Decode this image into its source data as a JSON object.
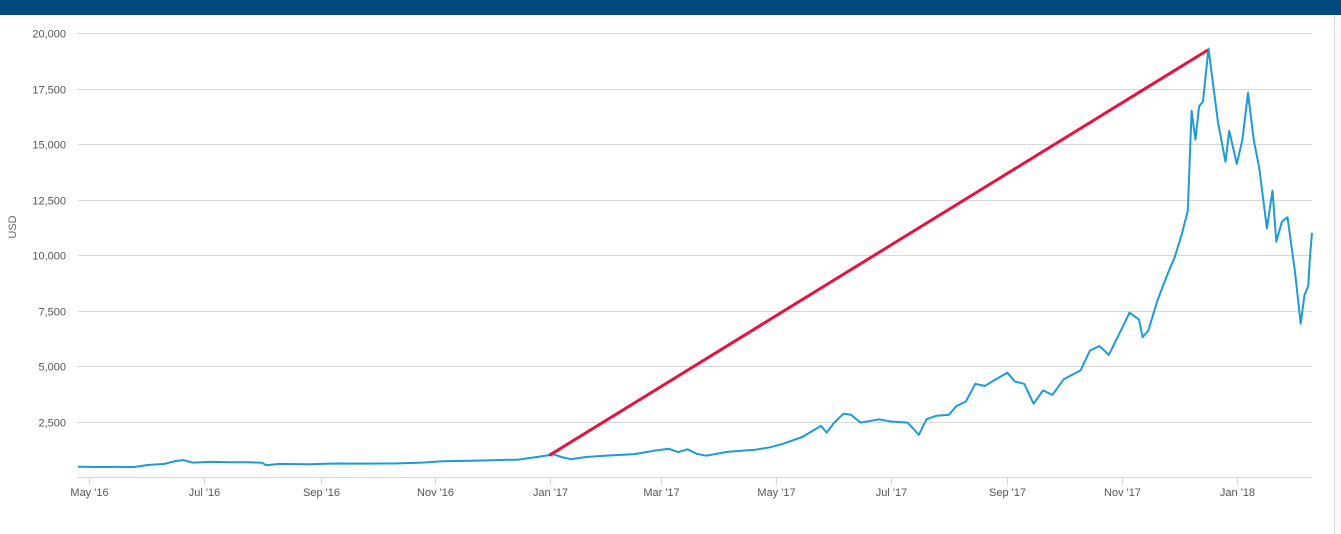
{
  "colors": {
    "header_bar": "#004a80",
    "series": "#1e9bd7",
    "annotation": "#e3143e",
    "grid": "#d8d8d8",
    "axis": "#ccd6eb"
  },
  "chart_data": {
    "type": "line",
    "title": "",
    "ylabel": "USD",
    "xlabel": "",
    "ylim": [
      0,
      20000
    ],
    "xlim": [
      "2016-04-25",
      "2018-02-10"
    ],
    "grid": true,
    "legend": "none",
    "y_ticks": [
      {
        "value": 2500,
        "label": "2,500"
      },
      {
        "value": 5000,
        "label": "5,000"
      },
      {
        "value": 7500,
        "label": "7,500"
      },
      {
        "value": 10000,
        "label": "10,000"
      },
      {
        "value": 12500,
        "label": "12,500"
      },
      {
        "value": 15000,
        "label": "15,000"
      },
      {
        "value": 17500,
        "label": "17,500"
      },
      {
        "value": 20000,
        "label": "20,000"
      }
    ],
    "x_ticks": [
      {
        "value": "2016-05-01",
        "label": "May '16"
      },
      {
        "value": "2016-07-01",
        "label": "Jul '16"
      },
      {
        "value": "2016-09-01",
        "label": "Sep '16"
      },
      {
        "value": "2016-11-01",
        "label": "Nov '16"
      },
      {
        "value": "2017-01-01",
        "label": "Jan '17"
      },
      {
        "value": "2017-03-01",
        "label": "Mar '17"
      },
      {
        "value": "2017-05-01",
        "label": "May '17"
      },
      {
        "value": "2017-07-01",
        "label": "Jul '17"
      },
      {
        "value": "2017-09-01",
        "label": "Sep '17"
      },
      {
        "value": "2017-11-01",
        "label": "Nov '17"
      },
      {
        "value": "2018-01-01",
        "label": "Jan '18"
      }
    ],
    "series": [
      {
        "points": [
          [
            "2016-04-25",
            460
          ],
          [
            "2016-05-05",
            450
          ],
          [
            "2016-05-15",
            455
          ],
          [
            "2016-05-25",
            450
          ],
          [
            "2016-06-01",
            540
          ],
          [
            "2016-06-10",
            590
          ],
          [
            "2016-06-16",
            720
          ],
          [
            "2016-06-20",
            760
          ],
          [
            "2016-06-25",
            650
          ],
          [
            "2016-07-05",
            680
          ],
          [
            "2016-07-15",
            665
          ],
          [
            "2016-07-25",
            660
          ],
          [
            "2016-08-01",
            640
          ],
          [
            "2016-08-03",
            530
          ],
          [
            "2016-08-10",
            590
          ],
          [
            "2016-08-25",
            575
          ],
          [
            "2016-09-10",
            610
          ],
          [
            "2016-09-25",
            605
          ],
          [
            "2016-10-10",
            610
          ],
          [
            "2016-10-25",
            650
          ],
          [
            "2016-11-05",
            710
          ],
          [
            "2016-11-20",
            735
          ],
          [
            "2016-12-01",
            755
          ],
          [
            "2016-12-15",
            785
          ],
          [
            "2016-12-25",
            900
          ],
          [
            "2017-01-03",
            1020
          ],
          [
            "2017-01-07",
            900
          ],
          [
            "2017-01-12",
            800
          ],
          [
            "2017-01-20",
            900
          ],
          [
            "2017-02-01",
            970
          ],
          [
            "2017-02-15",
            1030
          ],
          [
            "2017-02-25",
            1180
          ],
          [
            "2017-03-05",
            1270
          ],
          [
            "2017-03-10",
            1120
          ],
          [
            "2017-03-15",
            1250
          ],
          [
            "2017-03-20",
            1040
          ],
          [
            "2017-03-25",
            960
          ],
          [
            "2017-04-05",
            1130
          ],
          [
            "2017-04-20",
            1230
          ],
          [
            "2017-04-28",
            1340
          ],
          [
            "2017-05-05",
            1500
          ],
          [
            "2017-05-15",
            1800
          ],
          [
            "2017-05-20",
            2050
          ],
          [
            "2017-05-25",
            2300
          ],
          [
            "2017-05-28",
            2000
          ],
          [
            "2017-06-01",
            2450
          ],
          [
            "2017-06-06",
            2850
          ],
          [
            "2017-06-10",
            2800
          ],
          [
            "2017-06-15",
            2450
          ],
          [
            "2017-06-25",
            2600
          ],
          [
            "2017-07-01",
            2500
          ],
          [
            "2017-07-10",
            2450
          ],
          [
            "2017-07-16",
            1900
          ],
          [
            "2017-07-20",
            2600
          ],
          [
            "2017-07-25",
            2750
          ],
          [
            "2017-08-01",
            2800
          ],
          [
            "2017-08-05",
            3200
          ],
          [
            "2017-08-10",
            3400
          ],
          [
            "2017-08-15",
            4200
          ],
          [
            "2017-08-20",
            4100
          ],
          [
            "2017-08-25",
            4350
          ],
          [
            "2017-09-01",
            4700
          ],
          [
            "2017-09-05",
            4300
          ],
          [
            "2017-09-10",
            4200
          ],
          [
            "2017-09-15",
            3300
          ],
          [
            "2017-09-20",
            3900
          ],
          [
            "2017-09-25",
            3700
          ],
          [
            "2017-10-01",
            4400
          ],
          [
            "2017-10-10",
            4800
          ],
          [
            "2017-10-15",
            5700
          ],
          [
            "2017-10-20",
            5900
          ],
          [
            "2017-10-25",
            5500
          ],
          [
            "2017-11-01",
            6700
          ],
          [
            "2017-11-05",
            7400
          ],
          [
            "2017-11-10",
            7100
          ],
          [
            "2017-11-12",
            6300
          ],
          [
            "2017-11-15",
            6600
          ],
          [
            "2017-11-20",
            8000
          ],
          [
            "2017-11-26",
            9300
          ],
          [
            "2017-11-29",
            9900
          ],
          [
            "2017-12-03",
            11000
          ],
          [
            "2017-12-06",
            12000
          ],
          [
            "2017-12-08",
            16500
          ],
          [
            "2017-12-10",
            15200
          ],
          [
            "2017-12-12",
            16700
          ],
          [
            "2017-12-14",
            16900
          ],
          [
            "2017-12-17",
            19300
          ],
          [
            "2017-12-22",
            16000
          ],
          [
            "2017-12-26",
            14200
          ],
          [
            "2017-12-28",
            15600
          ],
          [
            "2018-01-01",
            14100
          ],
          [
            "2018-01-04",
            15200
          ],
          [
            "2018-01-07",
            17300
          ],
          [
            "2018-01-10",
            15200
          ],
          [
            "2018-01-13",
            13900
          ],
          [
            "2018-01-17",
            11200
          ],
          [
            "2018-01-20",
            12900
          ],
          [
            "2018-01-22",
            10600
          ],
          [
            "2018-01-25",
            11500
          ],
          [
            "2018-01-28",
            11700
          ],
          [
            "2018-02-01",
            9200
          ],
          [
            "2018-02-04",
            6900
          ],
          [
            "2018-02-06",
            8200
          ],
          [
            "2018-02-08",
            8600
          ],
          [
            "2018-02-09",
            10000
          ],
          [
            "2018-02-10",
            11000
          ]
        ]
      }
    ],
    "annotations": [
      {
        "type": "trend-line",
        "from": [
          "2017-01-01",
          1000
        ],
        "to": [
          "2017-12-16",
          19200
        ]
      }
    ]
  }
}
